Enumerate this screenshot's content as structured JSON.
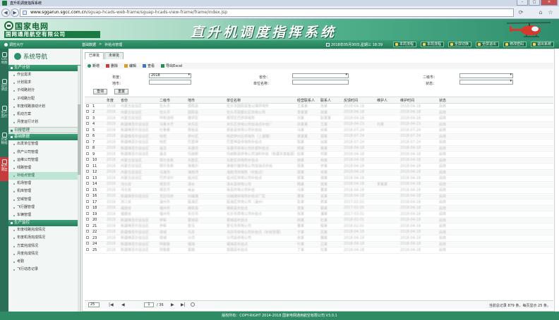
{
  "browser": {
    "tab_title": "直升机调度指挥系统",
    "url_host": "www.sggarun.sgcc.com.cn",
    "url_path": "/sguap-hcads-web-frame/sguap-hcads-view-frame/frame/index.jsp",
    "min": "–",
    "max": "□",
    "close": "✕",
    "back": "◀",
    "forward": "▶",
    "refresh": "⟳"
  },
  "header": {
    "logo_cn": "国家电网",
    "logo_sub": "国网通用航空有限公司",
    "title": "直升机调度指挥系统"
  },
  "topbar": {
    "user": "调控大厅",
    "datetime": "2018年05月30日,星期三 18:39",
    "buttons": [
      "本局流程",
      "本局流程",
      "全屏切换",
      "全屏退出",
      "修改密码",
      "退出系统"
    ]
  },
  "iconbar": [
    {
      "label": "GIS 地图"
    },
    {
      "label": "运行调度"
    },
    {
      "label": "生产监控"
    },
    {
      "label": "历史数据"
    },
    {
      "label": "生产调度"
    }
  ],
  "sidebar": {
    "title": "系统导航",
    "groups": [
      {
        "label": "生产计划",
        "items": [
          "作业需求",
          "计划需求",
          "子线路划分",
          "子线路分配",
          "年度线路滚动计划",
          "机动方案",
          "月度运行计划"
        ]
      },
      {
        "label": "日报管理",
        "items": []
      },
      {
        "label": "基础数据",
        "items": [
          "出发单位管理",
          "供产公司管理",
          "运维公司管理",
          "线路管理",
          "补给点管理",
          "机场管理",
          "机库管理",
          "空域管理",
          "飞行器管理",
          "车辆管理"
        ]
      },
      {
        "label": "生产监控",
        "items": [
          "年度线路完成情况",
          "年度机场完成情况",
          "方案完成情况",
          "月度完成情况",
          "考勤",
          "飞行动态记录"
        ]
      }
    ]
  },
  "breadcrumb": [
    "基础数据",
    ">",
    "补给点管理"
  ],
  "tabs": [
    "已审批",
    "未审批"
  ],
  "toolbar": [
    {
      "label": "新增",
      "icon": "plus-icon",
      "color": "#2f8e6d"
    },
    {
      "label": "删除",
      "icon": "delete-icon",
      "color": "#c63b3b"
    },
    {
      "label": "编辑",
      "icon": "edit-icon",
      "color": "#d4a12a"
    },
    {
      "label": "查看",
      "icon": "view-icon",
      "color": "#3c78c4"
    },
    {
      "label": "导出Excel",
      "icon": "excel-icon",
      "color": "#2e8b4f"
    }
  ],
  "filters": {
    "year_label": "年度：",
    "year_value": "2018",
    "province_label": "省份：",
    "province_value": "",
    "city_label": "二级市：",
    "city_value": "",
    "district_label": "地市：",
    "unit_label": "单位名称：",
    "status_label": "状态：",
    "status_value": "",
    "query_btn": "查询",
    "reset_btn": "重置"
  },
  "grid": {
    "columns": [
      "",
      "",
      "年度",
      "省份",
      "二级市",
      "地市",
      "单位名称",
      "经营联系人",
      "联系人",
      "反馈时间",
      "维护人",
      "维护时间",
      "状态"
    ],
    "rows": [
      [
        "1",
        "2018",
        "内蒙古自治区",
        "包头市",
        "固阳县",
        "包头市固阳县金山镇供电所",
        "王某某",
        "张某",
        "2018-04-18",
        "",
        "2018-04-18",
        "启用"
      ],
      [
        "2",
        "2018",
        "内蒙古自治区",
        "包头市",
        "固阳县",
        "包头市昆都仑区供电公司",
        "李某某",
        "张某",
        "2018-04-18",
        "",
        "2018-04-18",
        "启用"
      ],
      [
        "3",
        "2018",
        "内蒙古自治区",
        "呼和浩特",
        "赛罕区",
        "赛罕区巴彦供电所",
        "刘某",
        "赵某某",
        "2018-04-18",
        "",
        "2018-04-18",
        "启用"
      ],
      [
        "4",
        "2018",
        "新疆维吾尔自治区",
        "乌鲁木齐",
        "米东区",
        "米东区供电公司加油点补给厂",
        "孙某某",
        "王某",
        "2018-04-23",
        "刘某",
        "2018-04-23",
        "启用"
      ],
      [
        "5",
        "2018",
        "新疆维吾尔自治区",
        "吐鲁番",
        "鄯善县",
        "鄯善县供电公司补给站",
        "马某",
        "周某",
        "2018-07-24",
        "",
        "2018-07-24",
        "启用"
      ],
      [
        "6",
        "2018",
        "新疆维吾尔自治区",
        "哈密",
        "伊州区",
        "哈密伊州区供电所（上湖镇）",
        "吴某某",
        "郑某",
        "2018-07-24",
        "",
        "2018-07-24",
        "启用"
      ],
      [
        "7",
        "2018",
        "新疆维吾尔自治区",
        "哈密",
        "巴里坤",
        "巴里坤县供电所补给点",
        "陈某",
        "周某",
        "2018-07-24",
        "",
        "2018-07-24",
        "启用"
      ],
      [
        "8",
        "2018",
        "新疆维吾尔自治区",
        "昌吉",
        "阜康市",
        "阜康市供电公司外部补给点",
        "杨某",
        "黄某",
        "2018-04-18",
        "",
        "2018-04-18",
        "启用"
      ],
      [
        "9",
        "2018",
        "新疆维吾尔自治区",
        "昌吉",
        "玛纳斯",
        "玛纳斯县供电公司油料补给（新疆天富能源）",
        "赵某",
        "何某",
        "2018-04-18",
        "",
        "2018-04-18",
        "启用"
      ],
      [
        "10",
        "2018",
        "内蒙古自治区",
        "鄂尔多斯",
        "东胜区",
        "东胜区供电所补给点",
        "徐某",
        "林某",
        "2018-04-18",
        "",
        "2018-04-18",
        "启用"
      ],
      [
        "11",
        "2018",
        "内蒙古自治区",
        "鄂尔多斯",
        "准格尔",
        "准格尔旗供电公司加油点补给",
        "高某",
        "罗某",
        "2018-04-18",
        "",
        "2018-04-18",
        "启用"
      ],
      [
        "12",
        "2018",
        "内蒙古自治区",
        "乌海市",
        "海勃湾",
        "海勃湾供电所（补给点）",
        "梁某",
        "宋某",
        "2018-04-18",
        "",
        "2018-04-18",
        "启用"
      ],
      [
        "13",
        "2018",
        "内蒙古自治区",
        "巴彦淖尔",
        "临河区",
        "临河区供电公司补给点",
        "郭某",
        "谢某",
        "2018-04-18",
        "",
        "2018-04-18",
        "启用"
      ],
      [
        "14",
        "2018",
        "河北省",
        "保定市",
        "涞水",
        "涞水县供电公司",
        "韩某",
        "唐某",
        "2018-04-18",
        "李某某",
        "2018-04-18",
        "启用"
      ],
      [
        "15",
        "2018",
        "河北省",
        "保定市",
        "易县",
        "易县供电公司补给",
        "冯某",
        "董某",
        "2018-04-18",
        "",
        "2018-04-18",
        "启用"
      ],
      [
        "16",
        "2018",
        "新疆维吾尔自治区",
        "克拉玛依",
        "白碱滩",
        "白碱滩供电所补给点厂区",
        "曹某",
        "袁某",
        "2018-04-18",
        "",
        "2018-04-18",
        "启用"
      ],
      [
        "17",
        "2018",
        "浙江省",
        "温州市",
        "瓯海区",
        "瓯海区供电公司（温州）",
        "彭某",
        "蒋某",
        "2017-02-01",
        "",
        "2018-04-18",
        "启用"
      ],
      [
        "18",
        "2018",
        "福建省",
        "福州市",
        "闽侯县",
        "闽侯县补给点",
        "曾某",
        "蔡某",
        "2017-02-05",
        "",
        "2018-04-18",
        "启用"
      ],
      [
        "19",
        "2018",
        "福建省",
        "福州市",
        "长乐市",
        "长乐市供电公司补给点",
        "肖某",
        "潘某",
        "2017-03-01",
        "",
        "2018-04-18",
        "启用"
      ],
      [
        "20",
        "2018",
        "新疆维吾尔自治区",
        "伊犁",
        "霍城县",
        "霍城县补给点",
        "田某",
        "杜某",
        "2018-02-01",
        "",
        "2018-04-18",
        "启用"
      ],
      [
        "21",
        "2018",
        "新疆维吾尔自治区",
        "伊犁",
        "奎屯",
        "奎屯市供电公司",
        "董某",
        "程某",
        "2018-02-01",
        "",
        "2018-04-18",
        "启用"
      ],
      [
        "22",
        "2018",
        "新疆维吾尔自治区",
        "塔城",
        "乌苏",
        "乌苏市供电公司补给点（补给管理）",
        "于某",
        "苏某",
        "2018-04-18",
        "",
        "2018-04-18",
        "启用"
      ],
      [
        "23",
        "2018",
        "新疆维吾尔自治区",
        "塔城",
        "沙湾",
        "沙湾县供电公司",
        "余某",
        "魏某",
        "2018-04-18",
        "",
        "2018-04-18",
        "启用"
      ],
      [
        "24",
        "2018",
        "新疆维吾尔自治区",
        "阿勒泰",
        "福海",
        "福海县补给点",
        "叶某",
        "吕某",
        "2018-04-18",
        "",
        "2018-04-18",
        "启用"
      ],
      [
        "25",
        "2018",
        "新疆维吾尔自治区",
        "阿勒泰",
        "富蕴",
        "富蕴县补给点",
        "丁某",
        "任某",
        "2018-04-18",
        "",
        "2018-04-18",
        "启用"
      ]
    ]
  },
  "pager": {
    "page_size": "25",
    "first": "|◀",
    "prev": "◀",
    "next": "▶",
    "last": "▶|",
    "page": "1",
    "total_pages": "/ 36",
    "info": "当前总记录 879 条，每页显示 25 条。"
  },
  "footer": "版权所有：COPY-RIGHT 2014-2018 国家电网通用航空有限公司 V3.0.1"
}
